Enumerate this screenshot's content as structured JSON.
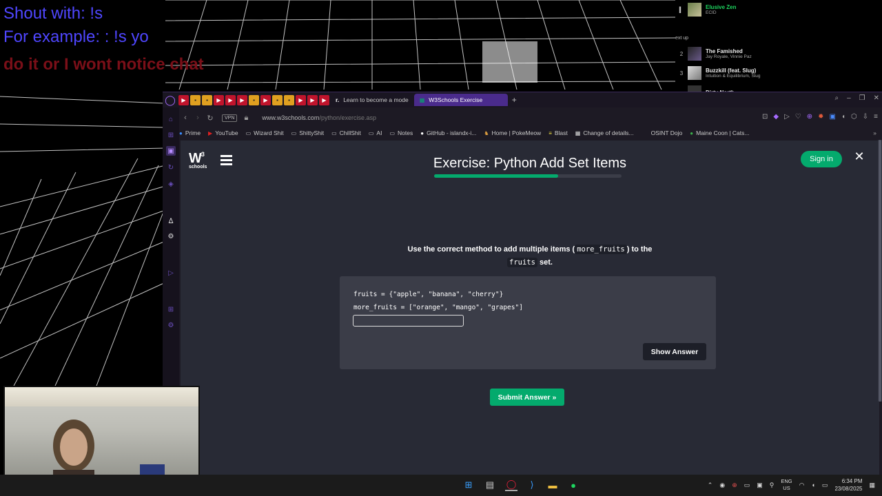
{
  "overlay": {
    "line1": "Shout with: !s",
    "line2": "For example: : !s yo",
    "line3": "do it or I wont notice chat"
  },
  "spotify": {
    "now_playing": {
      "title": "Elusive Zen",
      "artist": "ECID"
    },
    "next_up_label": "ext up",
    "queue": [
      {
        "num": "2",
        "title": "The Famished",
        "artist": "Jay Royale, Vinnie Paz"
      },
      {
        "num": "3",
        "title": "Buzzkill (feat. Slug)",
        "artist": "Intuition & Equilibrium, Slug"
      },
      {
        "num": "",
        "title": "Dirty North",
        "artist": ""
      }
    ]
  },
  "browser": {
    "tabs": [
      {
        "label": "Learn to become a mode"
      },
      {
        "label": "W3Schools Exercise"
      }
    ],
    "url": "www.w3schools.com",
    "url_path": "/python/exercise.asp",
    "vpn_label": "VPN",
    "bookmarks": [
      "Prime",
      "YouTube",
      "Wizard Shit",
      "ShittyShit",
      "ChillShit",
      "AI",
      "Notes",
      "GitHub - islandx-i...",
      "Home | PokeMeow",
      "Blast",
      "Change of details...",
      "OSINT Dojo",
      "Maine Coon | Cats..."
    ]
  },
  "w3": {
    "logo_main": "W",
    "logo_sup": "3",
    "logo_sub": "schools",
    "title": "Exercise: Python Add Set Items",
    "progress": 0.66,
    "signin_label": "Sign in",
    "close_glyph": "✕",
    "instruction_pre": "Use the correct method to add multiple items (",
    "instruction_code1": "more_fruits",
    "instruction_mid": ") to the",
    "instruction_code2": "fruits",
    "instruction_post": "set.",
    "code_line1": "fruits = {\"apple\", \"banana\", \"cherry\"}",
    "code_line2": "more_fruits = [\"orange\", \"mango\", \"grapes\"]",
    "answer_value": "",
    "show_answer_label": "Show Answer",
    "submit_label": "Submit Answer »"
  },
  "taskbar": {
    "lang_top": "ENG",
    "lang_bottom": "US",
    "time": "6:34 PM",
    "date": "23/08/2025"
  },
  "colors": {
    "w3_bg": "#282a35",
    "w3_green": "#04aa6d",
    "code_bg": "#3b3d48",
    "overlay_blue": "#4f46ff",
    "overlay_red": "#7a0f18"
  }
}
